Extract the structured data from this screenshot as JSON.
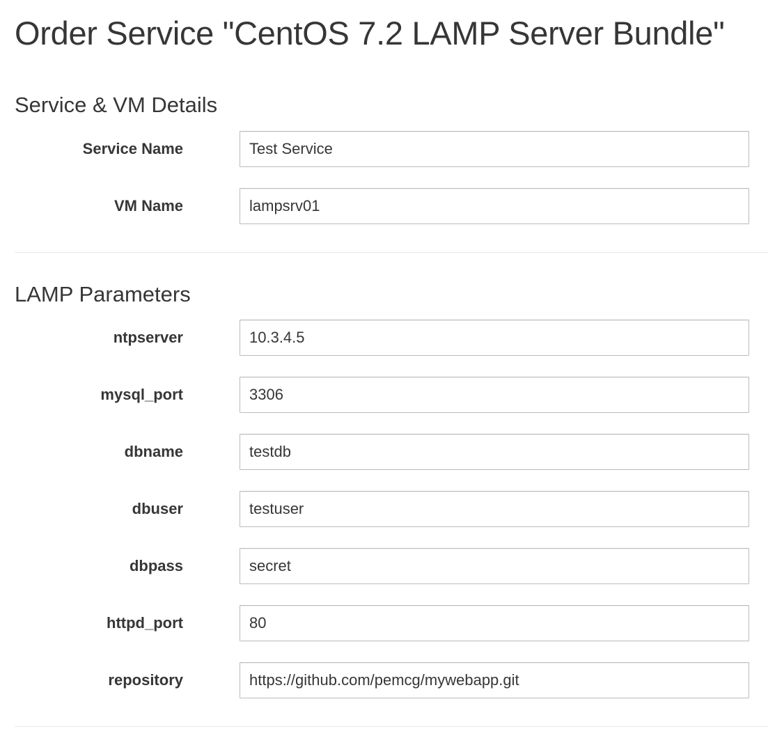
{
  "page": {
    "title": "Order Service \"CentOS 7.2 LAMP Server Bundle\""
  },
  "sections": [
    {
      "title": "Service & VM Details",
      "fields": [
        {
          "label": "Service Name",
          "value": "Test Service"
        },
        {
          "label": "VM Name",
          "value": "lampsrv01"
        }
      ]
    },
    {
      "title": "LAMP Parameters",
      "fields": [
        {
          "label": "ntpserver",
          "value": "10.3.4.5"
        },
        {
          "label": "mysql_port",
          "value": "3306"
        },
        {
          "label": "dbname",
          "value": "testdb"
        },
        {
          "label": "dbuser",
          "value": "testuser"
        },
        {
          "label": "dbpass",
          "value": "secret"
        },
        {
          "label": "httpd_port",
          "value": "80"
        },
        {
          "label": "repository",
          "value": "https://github.com/pemcg/mywebapp.git"
        }
      ]
    }
  ],
  "colors": {
    "text": "#363636",
    "input_border": "#bbbbbb",
    "divider": "#e7e7e7"
  }
}
